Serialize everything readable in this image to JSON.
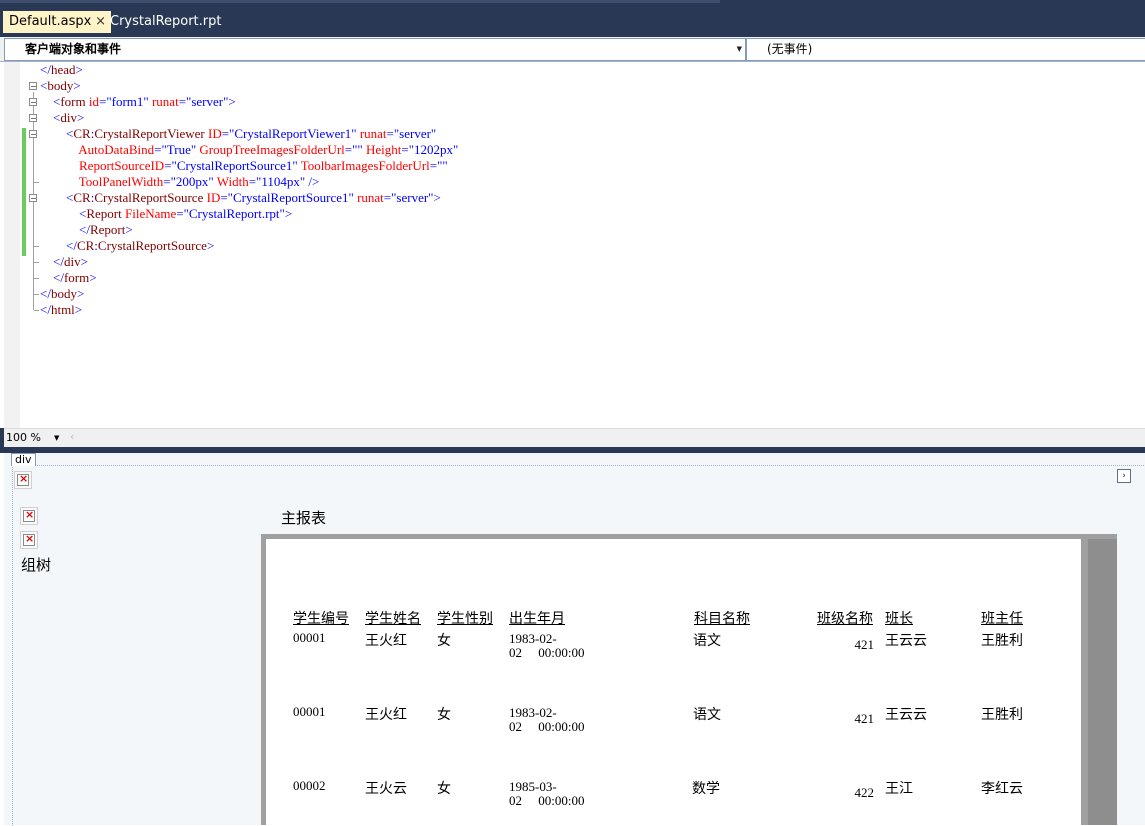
{
  "tabs": [
    {
      "label": "Default.aspx",
      "close": "×",
      "active": true
    },
    {
      "label": "CrystalReport.rpt",
      "active": false
    }
  ],
  "navbar": {
    "left_value": "客户端对象和事件",
    "right_value": "(无事件)"
  },
  "editor": {
    "zoom": "100 %",
    "lines": [
      [
        {
          "t": "</",
          "c": "pn"
        },
        {
          "t": "head",
          "c": "tg"
        },
        {
          "t": ">",
          "c": "pn"
        }
      ],
      [
        {
          "t": "<",
          "c": "pn"
        },
        {
          "t": "body",
          "c": "tg"
        },
        {
          "t": ">",
          "c": "pn"
        }
      ],
      [
        {
          "t": "    <",
          "c": "pn"
        },
        {
          "t": "form ",
          "c": "tg"
        },
        {
          "t": "id",
          "c": "at"
        },
        {
          "t": "=\"form1\" ",
          "c": "vl"
        },
        {
          "t": "runat",
          "c": "at"
        },
        {
          "t": "=\"server\">",
          "c": "vl"
        }
      ],
      [
        {
          "t": "    <",
          "c": "pn"
        },
        {
          "t": "div",
          "c": "tg"
        },
        {
          "t": ">",
          "c": "pn"
        }
      ],
      [
        {
          "t": "        <",
          "c": "pn"
        },
        {
          "t": "CR",
          "c": "tg"
        },
        {
          "t": ":",
          "c": "pn"
        },
        {
          "t": "CrystalReportViewer ",
          "c": "tg"
        },
        {
          "t": "ID",
          "c": "at"
        },
        {
          "t": "=\"CrystalReportViewer1\" ",
          "c": "vl"
        },
        {
          "t": "runat",
          "c": "at"
        },
        {
          "t": "=\"server\"",
          "c": "vl"
        }
      ],
      [
        {
          "t": "            ",
          "c": "pn"
        },
        {
          "t": "AutoDataBind",
          "c": "at"
        },
        {
          "t": "=\"True\" ",
          "c": "vl"
        },
        {
          "t": "GroupTreeImagesFolderUrl",
          "c": "at"
        },
        {
          "t": "=\"\" ",
          "c": "vl"
        },
        {
          "t": "Height",
          "c": "at"
        },
        {
          "t": "=\"1202px\"",
          "c": "vl"
        }
      ],
      [
        {
          "t": "            ",
          "c": "pn"
        },
        {
          "t": "ReportSourceID",
          "c": "at"
        },
        {
          "t": "=\"CrystalReportSource1\" ",
          "c": "vl"
        },
        {
          "t": "ToolbarImagesFolderUrl",
          "c": "at"
        },
        {
          "t": "=\"\"",
          "c": "vl"
        }
      ],
      [
        {
          "t": "            ",
          "c": "pn"
        },
        {
          "t": "ToolPanelWidth",
          "c": "at"
        },
        {
          "t": "=\"200px\" ",
          "c": "vl"
        },
        {
          "t": "Width",
          "c": "at"
        },
        {
          "t": "=\"1104px\" />",
          "c": "vl"
        }
      ],
      [
        {
          "t": "        <",
          "c": "pn"
        },
        {
          "t": "CR",
          "c": "tg"
        },
        {
          "t": ":",
          "c": "pn"
        },
        {
          "t": "CrystalReportSource ",
          "c": "tg"
        },
        {
          "t": "ID",
          "c": "at"
        },
        {
          "t": "=\"CrystalReportSource1\" ",
          "c": "vl"
        },
        {
          "t": "runat",
          "c": "at"
        },
        {
          "t": "=\"server\">",
          "c": "vl"
        }
      ],
      [
        {
          "t": "            <",
          "c": "pn"
        },
        {
          "t": "Report ",
          "c": "tg"
        },
        {
          "t": "FileName",
          "c": "at"
        },
        {
          "t": "=\"CrystalReport.rpt\">",
          "c": "vl"
        }
      ],
      [
        {
          "t": "            </",
          "c": "pn"
        },
        {
          "t": "Report",
          "c": "tg"
        },
        {
          "t": ">",
          "c": "pn"
        }
      ],
      [
        {
          "t": "        </",
          "c": "pn"
        },
        {
          "t": "CR",
          "c": "tg"
        },
        {
          "t": ":",
          "c": "pn"
        },
        {
          "t": "CrystalReportSource",
          "c": "tg"
        },
        {
          "t": ">",
          "c": "pn"
        }
      ],
      [
        {
          "t": "    </",
          "c": "pn"
        },
        {
          "t": "div",
          "c": "tg"
        },
        {
          "t": ">",
          "c": "pn"
        }
      ],
      [
        {
          "t": "    </",
          "c": "pn"
        },
        {
          "t": "form",
          "c": "tg"
        },
        {
          "t": ">",
          "c": "pn"
        }
      ],
      [
        {
          "t": "</",
          "c": "pn"
        },
        {
          "t": "body",
          "c": "tg"
        },
        {
          "t": ">",
          "c": "pn"
        }
      ],
      [
        {
          "t": "</",
          "c": "pn"
        },
        {
          "t": "html",
          "c": "tg"
        },
        {
          "t": ">",
          "c": "pn"
        }
      ]
    ]
  },
  "design": {
    "div_tag": "div",
    "group_tree_label": "组树",
    "report_title": "主报表",
    "columns": [
      "学生编号",
      "学生姓名",
      "学生性别",
      "出生年月",
      "科目名称",
      "班级名称",
      "班长",
      "班主任"
    ],
    "rows": [
      {
        "id": "00001",
        "name": "王火红",
        "gender": "女",
        "birth": "1983-02-\n02     00:00:00",
        "subject": "语文",
        "class": "421",
        "monitor": "王云云",
        "teacher": "王胜利"
      },
      {
        "id": "00001",
        "name": "王火红",
        "gender": "女",
        "birth": "1983-02-\n02     00:00:00",
        "subject": "语文",
        "class": "421",
        "monitor": "王云云",
        "teacher": "王胜利"
      },
      {
        "id": "00002",
        "name": "王火云",
        "gender": "女",
        "birth": "1985-03-\n02     00:00:00",
        "subject": "数学",
        "class": "422",
        "monitor": "王江",
        "teacher": "李红云"
      }
    ]
  }
}
